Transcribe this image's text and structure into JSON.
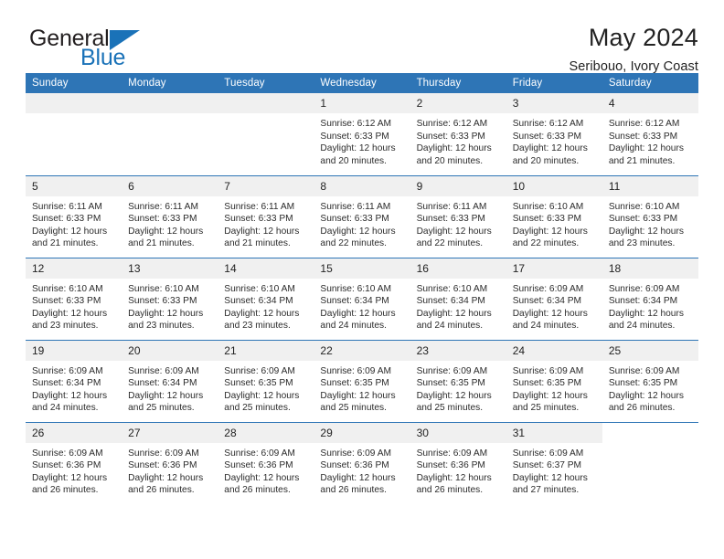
{
  "brand": {
    "name_part1": "General",
    "name_part2": "Blue",
    "accent_color": "#1a72b8"
  },
  "header": {
    "title": "May 2024",
    "subtitle": "Seribouo, Ivory Coast"
  },
  "theme": {
    "header_row_color": "#2e75b6",
    "date_band_color": "#f0f0f0",
    "text_color": "#222222"
  },
  "weekday_headers": [
    "Sunday",
    "Monday",
    "Tuesday",
    "Wednesday",
    "Thursday",
    "Friday",
    "Saturday"
  ],
  "labels": {
    "sunrise_prefix": "Sunrise:",
    "sunset_prefix": "Sunset:",
    "daylight_prefix": "Daylight:"
  },
  "weeks": [
    [
      {
        "day": "",
        "empty": true
      },
      {
        "day": "",
        "empty": true
      },
      {
        "day": "",
        "empty": true
      },
      {
        "day": "1",
        "sunrise": "Sunrise: 6:12 AM",
        "sunset": "Sunset: 6:33 PM",
        "daylight_line1": "Daylight: 12 hours",
        "daylight_line2": "and 20 minutes."
      },
      {
        "day": "2",
        "sunrise": "Sunrise: 6:12 AM",
        "sunset": "Sunset: 6:33 PM",
        "daylight_line1": "Daylight: 12 hours",
        "daylight_line2": "and 20 minutes."
      },
      {
        "day": "3",
        "sunrise": "Sunrise: 6:12 AM",
        "sunset": "Sunset: 6:33 PM",
        "daylight_line1": "Daylight: 12 hours",
        "daylight_line2": "and 20 minutes."
      },
      {
        "day": "4",
        "sunrise": "Sunrise: 6:12 AM",
        "sunset": "Sunset: 6:33 PM",
        "daylight_line1": "Daylight: 12 hours",
        "daylight_line2": "and 21 minutes."
      }
    ],
    [
      {
        "day": "5",
        "sunrise": "Sunrise: 6:11 AM",
        "sunset": "Sunset: 6:33 PM",
        "daylight_line1": "Daylight: 12 hours",
        "daylight_line2": "and 21 minutes."
      },
      {
        "day": "6",
        "sunrise": "Sunrise: 6:11 AM",
        "sunset": "Sunset: 6:33 PM",
        "daylight_line1": "Daylight: 12 hours",
        "daylight_line2": "and 21 minutes."
      },
      {
        "day": "7",
        "sunrise": "Sunrise: 6:11 AM",
        "sunset": "Sunset: 6:33 PM",
        "daylight_line1": "Daylight: 12 hours",
        "daylight_line2": "and 21 minutes."
      },
      {
        "day": "8",
        "sunrise": "Sunrise: 6:11 AM",
        "sunset": "Sunset: 6:33 PM",
        "daylight_line1": "Daylight: 12 hours",
        "daylight_line2": "and 22 minutes."
      },
      {
        "day": "9",
        "sunrise": "Sunrise: 6:11 AM",
        "sunset": "Sunset: 6:33 PM",
        "daylight_line1": "Daylight: 12 hours",
        "daylight_line2": "and 22 minutes."
      },
      {
        "day": "10",
        "sunrise": "Sunrise: 6:10 AM",
        "sunset": "Sunset: 6:33 PM",
        "daylight_line1": "Daylight: 12 hours",
        "daylight_line2": "and 22 minutes."
      },
      {
        "day": "11",
        "sunrise": "Sunrise: 6:10 AM",
        "sunset": "Sunset: 6:33 PM",
        "daylight_line1": "Daylight: 12 hours",
        "daylight_line2": "and 23 minutes."
      }
    ],
    [
      {
        "day": "12",
        "sunrise": "Sunrise: 6:10 AM",
        "sunset": "Sunset: 6:33 PM",
        "daylight_line1": "Daylight: 12 hours",
        "daylight_line2": "and 23 minutes."
      },
      {
        "day": "13",
        "sunrise": "Sunrise: 6:10 AM",
        "sunset": "Sunset: 6:33 PM",
        "daylight_line1": "Daylight: 12 hours",
        "daylight_line2": "and 23 minutes."
      },
      {
        "day": "14",
        "sunrise": "Sunrise: 6:10 AM",
        "sunset": "Sunset: 6:34 PM",
        "daylight_line1": "Daylight: 12 hours",
        "daylight_line2": "and 23 minutes."
      },
      {
        "day": "15",
        "sunrise": "Sunrise: 6:10 AM",
        "sunset": "Sunset: 6:34 PM",
        "daylight_line1": "Daylight: 12 hours",
        "daylight_line2": "and 24 minutes."
      },
      {
        "day": "16",
        "sunrise": "Sunrise: 6:10 AM",
        "sunset": "Sunset: 6:34 PM",
        "daylight_line1": "Daylight: 12 hours",
        "daylight_line2": "and 24 minutes."
      },
      {
        "day": "17",
        "sunrise": "Sunrise: 6:09 AM",
        "sunset": "Sunset: 6:34 PM",
        "daylight_line1": "Daylight: 12 hours",
        "daylight_line2": "and 24 minutes."
      },
      {
        "day": "18",
        "sunrise": "Sunrise: 6:09 AM",
        "sunset": "Sunset: 6:34 PM",
        "daylight_line1": "Daylight: 12 hours",
        "daylight_line2": "and 24 minutes."
      }
    ],
    [
      {
        "day": "19",
        "sunrise": "Sunrise: 6:09 AM",
        "sunset": "Sunset: 6:34 PM",
        "daylight_line1": "Daylight: 12 hours",
        "daylight_line2": "and 24 minutes."
      },
      {
        "day": "20",
        "sunrise": "Sunrise: 6:09 AM",
        "sunset": "Sunset: 6:34 PM",
        "daylight_line1": "Daylight: 12 hours",
        "daylight_line2": "and 25 minutes."
      },
      {
        "day": "21",
        "sunrise": "Sunrise: 6:09 AM",
        "sunset": "Sunset: 6:35 PM",
        "daylight_line1": "Daylight: 12 hours",
        "daylight_line2": "and 25 minutes."
      },
      {
        "day": "22",
        "sunrise": "Sunrise: 6:09 AM",
        "sunset": "Sunset: 6:35 PM",
        "daylight_line1": "Daylight: 12 hours",
        "daylight_line2": "and 25 minutes."
      },
      {
        "day": "23",
        "sunrise": "Sunrise: 6:09 AM",
        "sunset": "Sunset: 6:35 PM",
        "daylight_line1": "Daylight: 12 hours",
        "daylight_line2": "and 25 minutes."
      },
      {
        "day": "24",
        "sunrise": "Sunrise: 6:09 AM",
        "sunset": "Sunset: 6:35 PM",
        "daylight_line1": "Daylight: 12 hours",
        "daylight_line2": "and 25 minutes."
      },
      {
        "day": "25",
        "sunrise": "Sunrise: 6:09 AM",
        "sunset": "Sunset: 6:35 PM",
        "daylight_line1": "Daylight: 12 hours",
        "daylight_line2": "and 26 minutes."
      }
    ],
    [
      {
        "day": "26",
        "sunrise": "Sunrise: 6:09 AM",
        "sunset": "Sunset: 6:36 PM",
        "daylight_line1": "Daylight: 12 hours",
        "daylight_line2": "and 26 minutes."
      },
      {
        "day": "27",
        "sunrise": "Sunrise: 6:09 AM",
        "sunset": "Sunset: 6:36 PM",
        "daylight_line1": "Daylight: 12 hours",
        "daylight_line2": "and 26 minutes."
      },
      {
        "day": "28",
        "sunrise": "Sunrise: 6:09 AM",
        "sunset": "Sunset: 6:36 PM",
        "daylight_line1": "Daylight: 12 hours",
        "daylight_line2": "and 26 minutes."
      },
      {
        "day": "29",
        "sunrise": "Sunrise: 6:09 AM",
        "sunset": "Sunset: 6:36 PM",
        "daylight_line1": "Daylight: 12 hours",
        "daylight_line2": "and 26 minutes."
      },
      {
        "day": "30",
        "sunrise": "Sunrise: 6:09 AM",
        "sunset": "Sunset: 6:36 PM",
        "daylight_line1": "Daylight: 12 hours",
        "daylight_line2": "and 26 minutes."
      },
      {
        "day": "31",
        "sunrise": "Sunrise: 6:09 AM",
        "sunset": "Sunset: 6:37 PM",
        "daylight_line1": "Daylight: 12 hours",
        "daylight_line2": "and 27 minutes."
      },
      {
        "day": "",
        "empty": true,
        "no_band": true
      }
    ]
  ]
}
